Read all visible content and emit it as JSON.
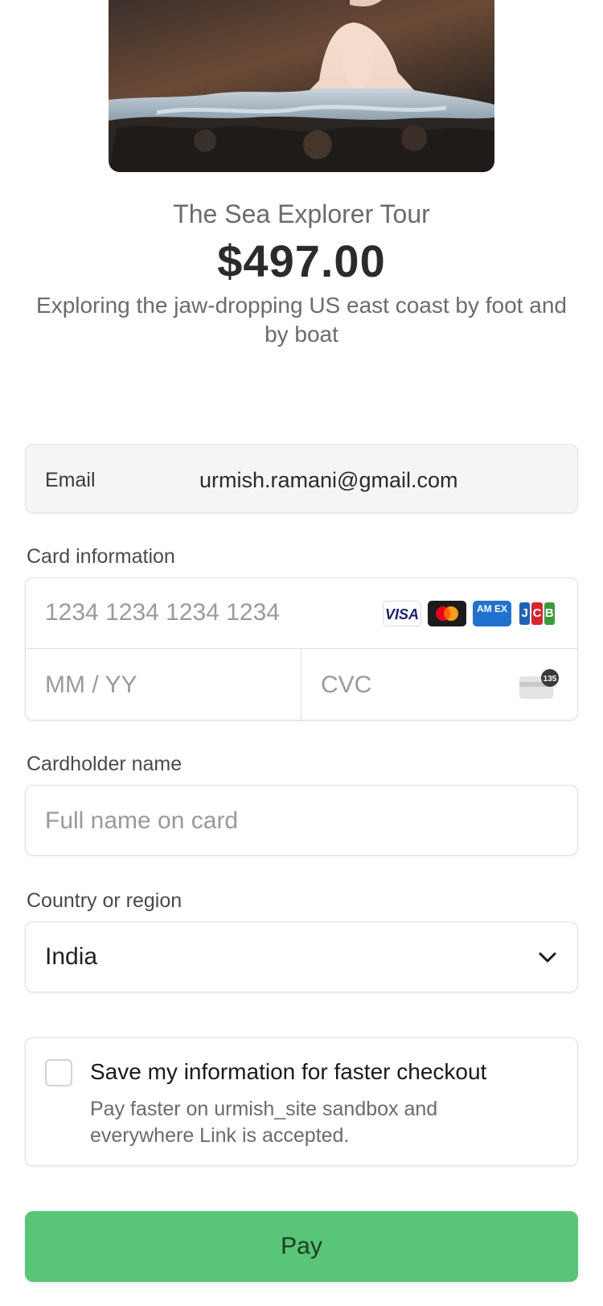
{
  "product": {
    "name": "The Sea Explorer Tour",
    "price": "$497.00",
    "description": "Exploring the jaw-dropping US east coast by foot and by boat"
  },
  "email": {
    "label": "Email",
    "value": "urmish.ramani@gmail.com"
  },
  "card": {
    "section_label": "Card information",
    "number_placeholder": "1234 1234 1234 1234",
    "expiry_placeholder": "MM / YY",
    "cvc_placeholder": "CVC",
    "brands": [
      "visa",
      "mastercard",
      "amex",
      "jcb"
    ],
    "brand_labels": {
      "visa": "VISA",
      "amex": "AM EX",
      "jcb": [
        "J",
        "C",
        "B"
      ]
    },
    "cvc_icon_badge": "135"
  },
  "cardholder": {
    "section_label": "Cardholder name",
    "placeholder": "Full name on card"
  },
  "country": {
    "section_label": "Country or region",
    "selected": "India"
  },
  "save_info": {
    "title": "Save my information for faster checkout",
    "subtitle": "Pay faster on urmish_site sandbox and everywhere Link is accepted.",
    "checked": false
  },
  "pay_button": {
    "label": "Pay"
  },
  "colors": {
    "pay_button": "#58c577",
    "visa_blue": "#1a1f71",
    "amex_blue": "#1f72cd",
    "jcb": [
      "#1f63b5",
      "#d8262d",
      "#3b9b3a"
    ]
  }
}
